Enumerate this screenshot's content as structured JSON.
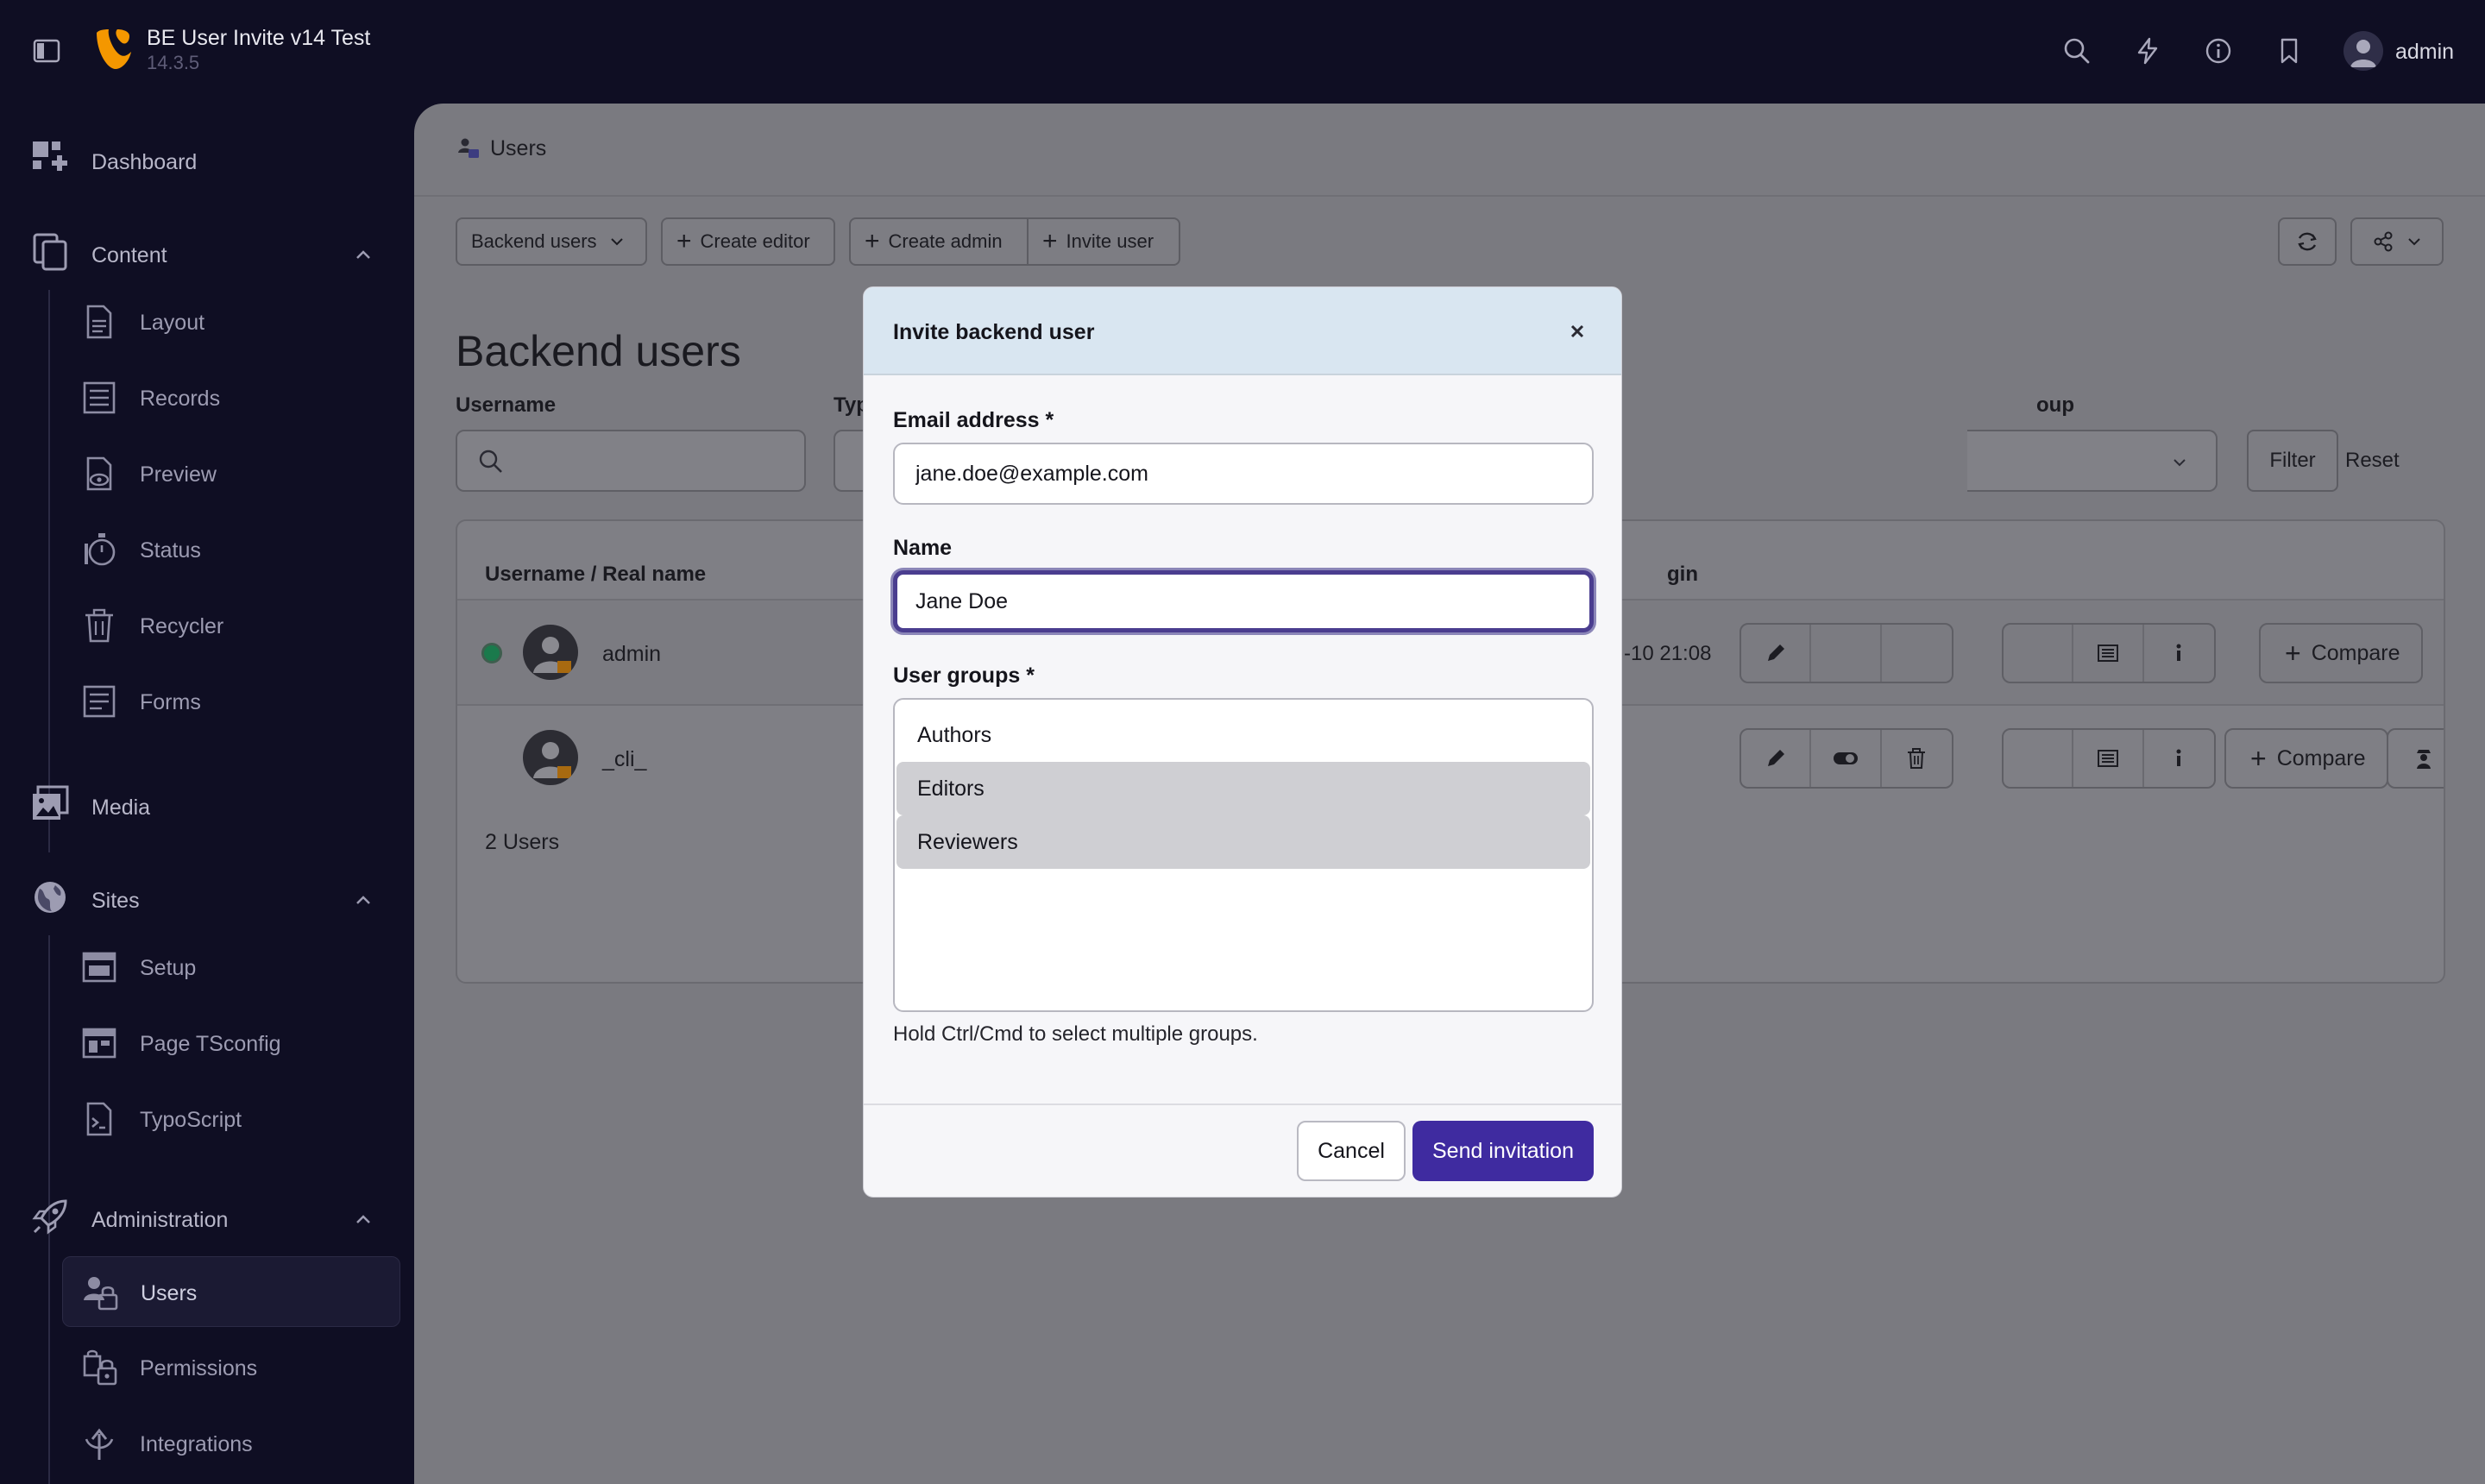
{
  "topbar": {
    "site_name": "BE User Invite v14 Test",
    "version": "14.3.5",
    "user": "admin"
  },
  "sidebar": {
    "dashboard": "Dashboard",
    "content": {
      "label": "Content",
      "items": [
        "Layout",
        "Records",
        "Preview",
        "Status",
        "Recycler",
        "Forms"
      ]
    },
    "media": "Media",
    "sites": {
      "label": "Sites",
      "items": [
        "Setup",
        "Page TSconfig",
        "TypoScript"
      ]
    },
    "administration": {
      "label": "Administration",
      "items": [
        "Users",
        "Permissions",
        "Integrations"
      ],
      "active": "Users"
    }
  },
  "main": {
    "breadcrumb": "Users",
    "toolbar": {
      "view_select": "Backend users",
      "create_editor": "Create editor",
      "create_admin": "Create admin",
      "invite_user": "Invite user"
    },
    "title": "Backend users",
    "filters": {
      "username_label": "Username",
      "type_label_partial": "Typ",
      "group_label_partial": "oup",
      "filter_button": "Filter",
      "reset_button": "Reset"
    },
    "table": {
      "col_username": "Username / Real name",
      "col_login_partial": "gin",
      "rows": [
        {
          "username": "admin",
          "last_login_partial": "-10 21:08",
          "online": true
        },
        {
          "username": "_cli_",
          "last_login_partial": "",
          "online": false
        }
      ],
      "compare_label": "Compare",
      "footer": "2 Users"
    }
  },
  "modal": {
    "title": "Invite backend user",
    "email_label": "Email address *",
    "email_value": "jane.doe@example.com",
    "name_label": "Name",
    "name_value": "Jane Doe",
    "groups_label": "User groups *",
    "groups": [
      {
        "label": "Authors",
        "selected": false
      },
      {
        "label": "Editors",
        "selected": true
      },
      {
        "label": "Reviewers",
        "selected": true
      }
    ],
    "groups_help": "Hold Ctrl/Cmd to select multiple groups.",
    "cancel": "Cancel",
    "send": "Send invitation"
  },
  "colors": {
    "sidebar_bg": "#0f0e23",
    "primary": "#3f2ba0",
    "modal_header": "#d9e6f1",
    "online_status": "#1a7a4c"
  }
}
